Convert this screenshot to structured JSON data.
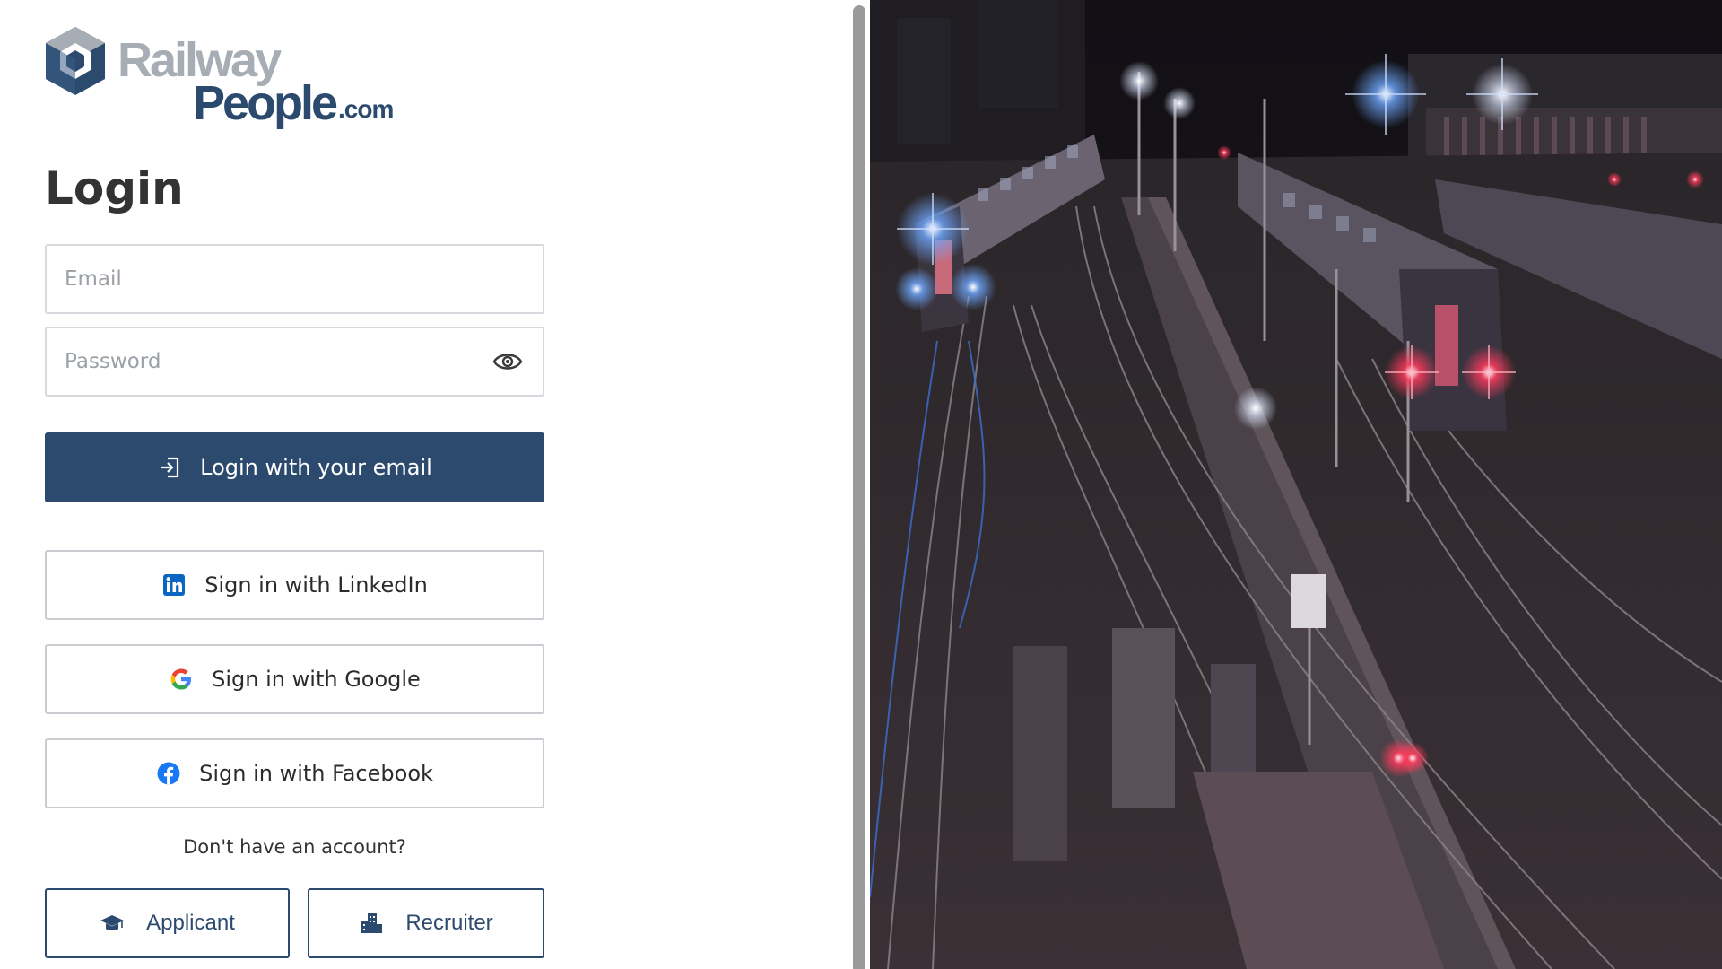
{
  "brand": {
    "logo_word_1": "Railway",
    "logo_word_2": "People",
    "logo_word_3": ".com"
  },
  "login": {
    "title": "Login",
    "email_placeholder": "Email",
    "password_placeholder": "Password",
    "login_button": "Login with your email"
  },
  "social": {
    "linkedin": "Sign in with LinkedIn",
    "google": "Sign in with Google",
    "facebook": "Sign in with Facebook"
  },
  "signup": {
    "prompt": "Don't have an account?",
    "applicant": "Applicant",
    "recruiter": "Recruiter"
  },
  "colors": {
    "brand_navy": "#2c4a6e",
    "brand_grey": "#a7adb5",
    "linkedin_blue": "#0a66c2",
    "facebook_blue": "#1877f2"
  },
  "icons": {
    "login_button": "login-arrow-icon",
    "password_toggle": "eye-icon",
    "linkedin": "linkedin-icon",
    "google": "google-icon",
    "facebook": "facebook-icon",
    "applicant": "graduation-cap-icon",
    "recruiter": "building-icon"
  }
}
